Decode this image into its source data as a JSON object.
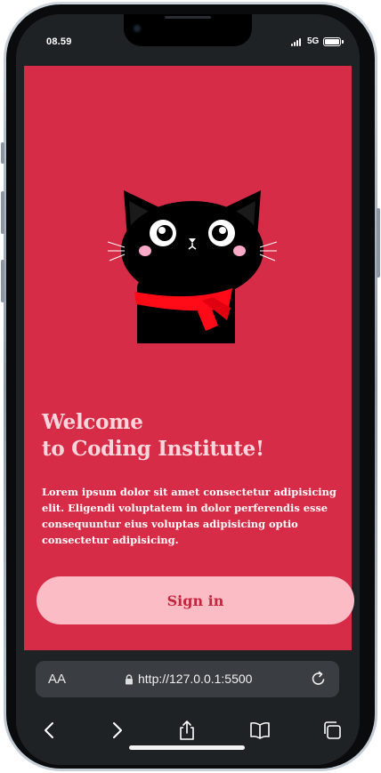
{
  "status_bar": {
    "time": "08.59",
    "network": "5G",
    "signal_icon": "signal-bars-icon",
    "battery_icon": "battery-icon"
  },
  "hero": {
    "image": "black-cat-with-red-scarf",
    "title_line1": "Welcome",
    "title_line2": "to Coding Institute!",
    "description": "Lorem ipsum dolor sit amet consectetur adipisicing elit. Eligendi voluptatem in dolor perferendis esse consequuntur eius voluptas adipisicing optio consectetur adipisicing.",
    "signin_label": "Sign in"
  },
  "browser": {
    "text_size_label": "AA",
    "url": "http://127.0.0.1:5500",
    "toolbar": [
      "back-icon",
      "forward-icon",
      "share-icon",
      "bookmarks-icon",
      "tabs-icon"
    ]
  },
  "colors": {
    "background": "#d72c47",
    "button": "#fbbcc6",
    "button_text": "#c4263e",
    "title_text": "#fcd5dc",
    "scarf": "#ff0a16"
  }
}
